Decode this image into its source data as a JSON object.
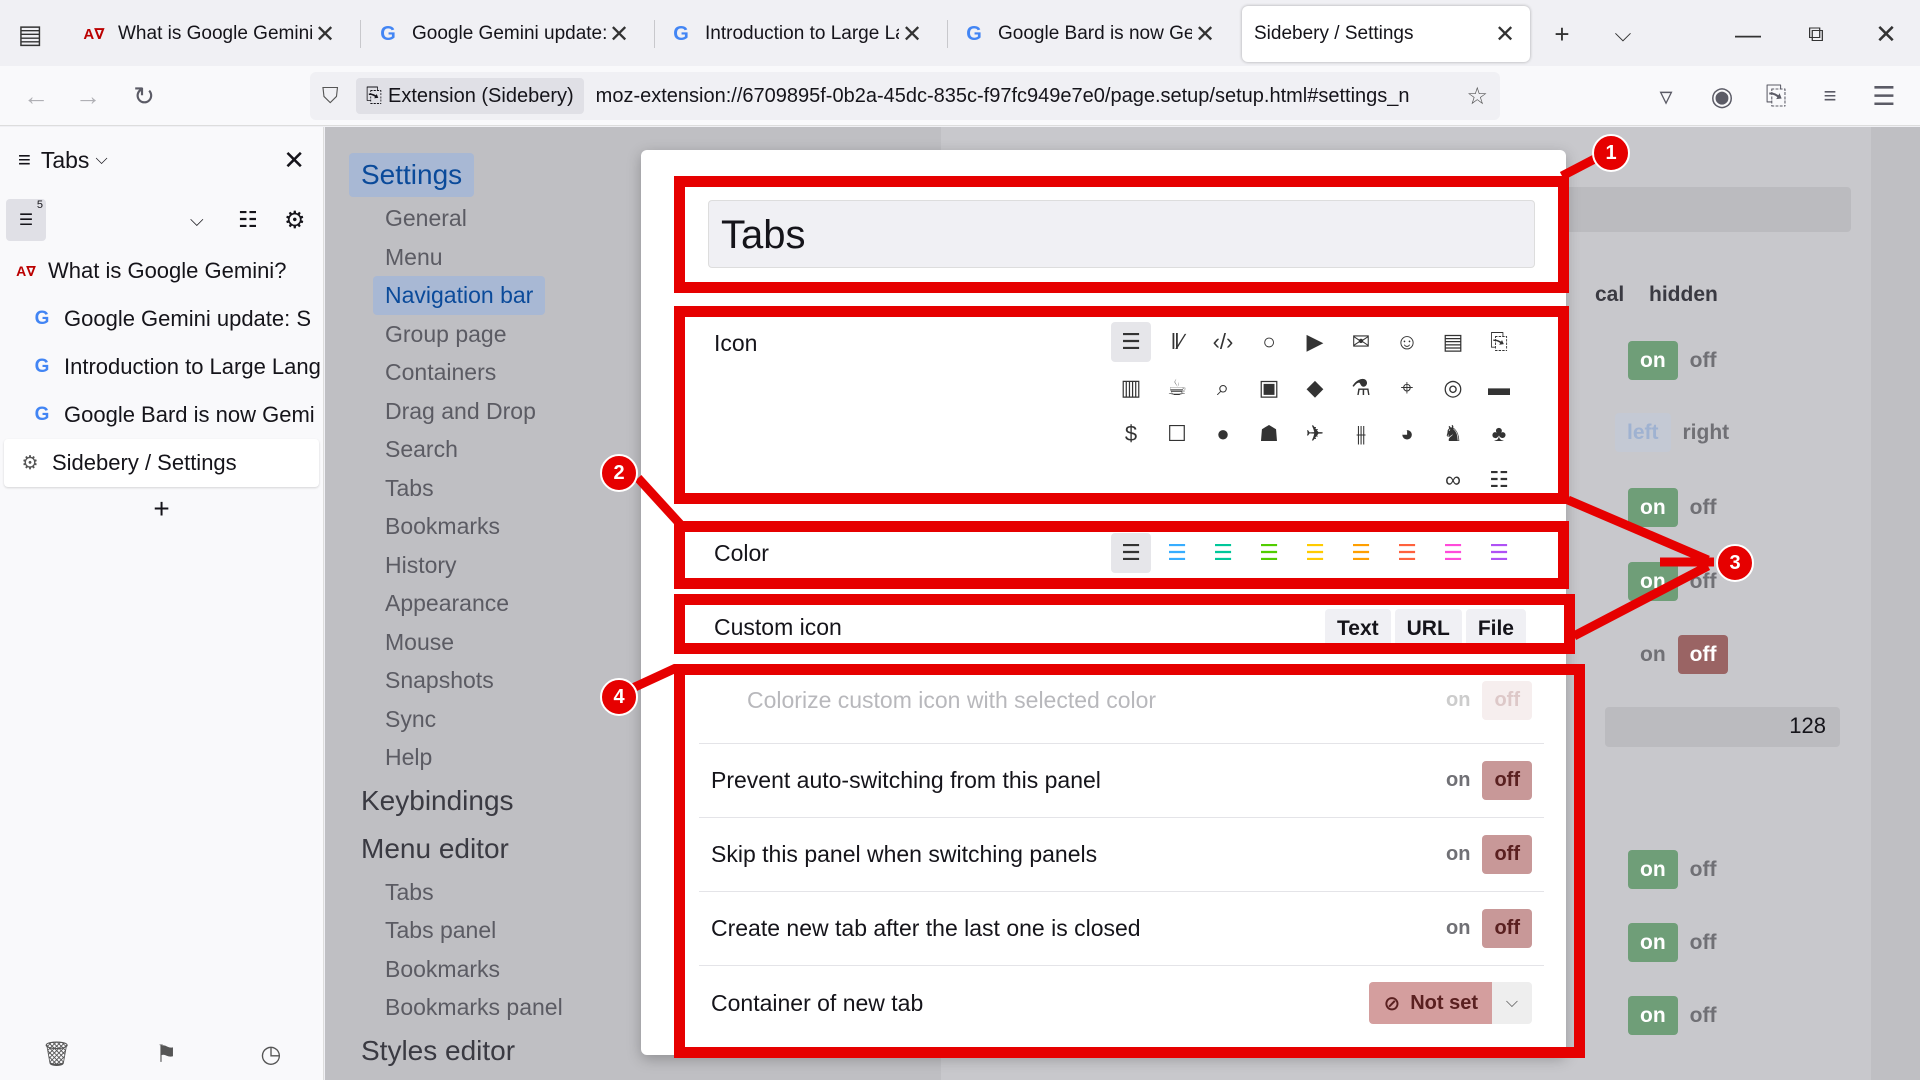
{
  "browser": {
    "tabs": [
      {
        "title": "What is Google Gemini?",
        "favicon": "av-icon"
      },
      {
        "title": "Google Gemini update: Su",
        "favicon": "google-icon"
      },
      {
        "title": "Introduction to Large Lang",
        "favicon": "google-icon"
      },
      {
        "title": "Google Bard is now Gemin",
        "favicon": "google-icon"
      },
      {
        "title": "Sidebery / Settings",
        "favicon": "none"
      }
    ],
    "identity_label": "Extension (Sidebery)",
    "url": "moz-extension://6709895f-0b2a-45dc-835c-f97fc949e7e0/page.setup/setup.html#settings_n"
  },
  "sidebar": {
    "panel_title": "Tabs",
    "panel_count": "5",
    "tabs": [
      {
        "title": "What is Google Gemini?",
        "favicon": "av-icon",
        "child": false
      },
      {
        "title": "Google Gemini update: S",
        "favicon": "google-icon",
        "child": true
      },
      {
        "title": "Introduction to Large Lang",
        "favicon": "google-icon",
        "child": true
      },
      {
        "title": "Google Bard is now Gemi",
        "favicon": "google-icon",
        "child": true
      },
      {
        "title": "Sidebery / Settings",
        "favicon": "gear-icon",
        "child": false
      }
    ],
    "add_label": "+"
  },
  "settings_nav": {
    "settings": "Settings",
    "items": [
      "General",
      "Menu",
      "Navigation bar",
      "Group page",
      "Containers",
      "Drag and Drop",
      "Search",
      "Tabs",
      "Bookmarks",
      "History",
      "Appearance",
      "Mouse",
      "Snapshots",
      "Sync",
      "Help"
    ],
    "keybindings": "Keybindings",
    "menu_editor": "Menu editor",
    "menu_editor_items": [
      "Tabs",
      "Tabs panel",
      "Bookmarks",
      "Bookmarks panel"
    ],
    "styles_editor": "Styles editor"
  },
  "background": {
    "col_cal": "cal",
    "col_hidden": "hidden",
    "on": "on",
    "off": "off",
    "left": "left",
    "right": "right",
    "number": "128"
  },
  "popup": {
    "name": "Tabs",
    "icon_label": "Icon",
    "color_label": "Color",
    "custom_icon_label": "Custom icon",
    "custom_icon_buttons": [
      "Text",
      "URL",
      "File"
    ],
    "options": [
      {
        "label": "Colorize custom icon with selected color",
        "dim": true
      },
      {
        "label": "Prevent auto-switching from this panel",
        "dim": false
      },
      {
        "label": "Skip this panel when switching panels",
        "dim": false
      },
      {
        "label": "Create new tab after the last one is closed",
        "dim": false
      }
    ],
    "on": "on",
    "off": "off",
    "container_label": "Container of new tab",
    "container_value": "Not set",
    "colors": [
      "#555555",
      "#37adff",
      "#00c79a",
      "#51cd00",
      "#ffcb00",
      "#ff9f00",
      "#ff613d",
      "#ff4bda",
      "#af51f5"
    ]
  },
  "annotations": [
    "1",
    "2",
    "3",
    "4"
  ]
}
